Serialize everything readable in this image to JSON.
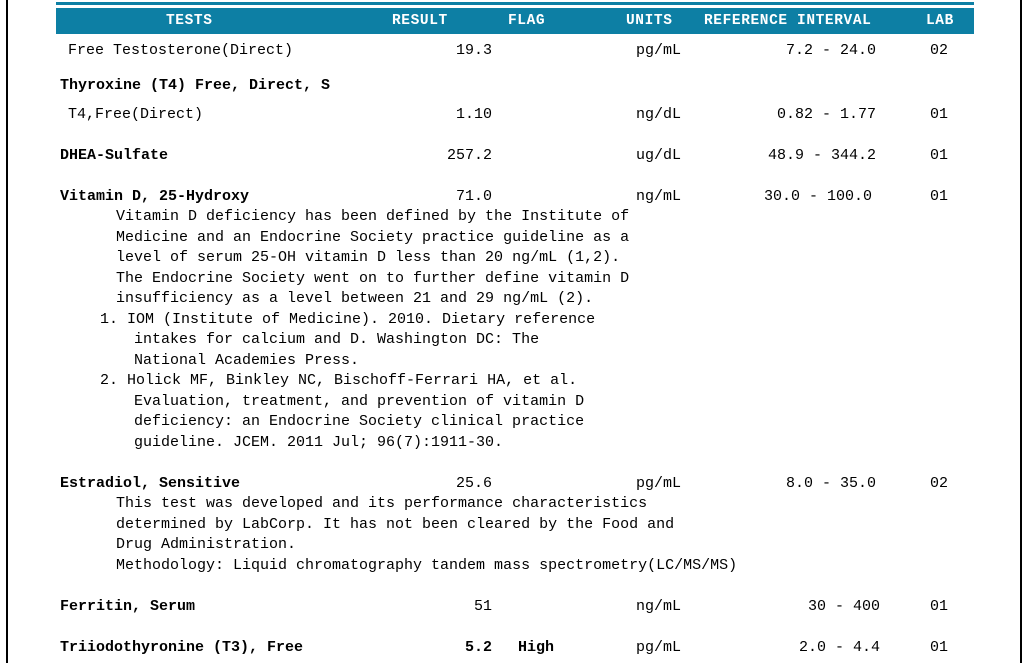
{
  "theme": {
    "header_bg": "#0d7fa4",
    "header_text": "#ffffff",
    "body_text": "#000000",
    "page_bg": "#ffffff",
    "border": "#000000"
  },
  "table": {
    "columns": {
      "tests": "TESTS",
      "result": "RESULT",
      "flag": "FLAG",
      "units": "UNITS",
      "reference_interval": "REFERENCE INTERVAL",
      "lab": "LAB"
    },
    "rows": [
      {
        "test": "Free Testosterone(Direct)",
        "bold": false,
        "result": "19.3",
        "flag": "",
        "units": "pg/mL",
        "reference": "7.2 - 24.0",
        "lab": "02"
      },
      {
        "test": "T4,Free(Direct)",
        "bold": false,
        "result": "1.10",
        "flag": "",
        "units": "ng/dL",
        "reference": "0.82 - 1.77",
        "lab": "01"
      },
      {
        "test": "DHEA-Sulfate",
        "bold": true,
        "result": "257.2",
        "flag": "",
        "units": "ug/dL",
        "reference": "48.9 - 344.2",
        "lab": "01"
      },
      {
        "test": "Vitamin D, 25-Hydroxy",
        "bold": true,
        "result": "71.0",
        "flag": "",
        "units": "ng/mL",
        "reference": "30.0 - 100.0",
        "lab": "01"
      },
      {
        "test": "Estradiol, Sensitive",
        "bold": true,
        "result": "25.6",
        "flag": "",
        "units": "pg/mL",
        "reference": "8.0 - 35.0",
        "lab": "02"
      },
      {
        "test": "Ferritin, Serum",
        "bold": true,
        "result": "51",
        "flag": "",
        "units": "ng/mL",
        "reference": "30 - 400",
        "lab": "01"
      },
      {
        "test": "Triiodothyronine (T3), Free",
        "bold": true,
        "result": "5.2",
        "flag": "High",
        "units": "pg/mL",
        "reference": "2.0 - 4.4",
        "lab": "01"
      }
    ],
    "group_headings": {
      "thyroxine": "Thyroxine (T4) Free, Direct, S"
    },
    "notes": {
      "vitamin_d": {
        "body": [
          "Vitamin D deficiency has been defined by the Institute of",
          "Medicine and an Endocrine Society practice guideline as a",
          "level of serum 25-OH vitamin D less than 20 ng/mL (1,2).",
          "The Endocrine Society went on to further define vitamin D",
          "insufficiency as a level between 21 and 29 ng/mL (2)."
        ],
        "references": [
          [
            "1. IOM (Institute of Medicine). 2010. Dietary reference",
            "intakes for calcium and D. Washington DC: The",
            "National Academies Press."
          ],
          [
            "2. Holick MF, Binkley NC, Bischoff-Ferrari HA, et al.",
            "Evaluation, treatment, and prevention of vitamin D",
            "deficiency: an Endocrine Society clinical practice",
            "guideline. JCEM. 2011 Jul; 96(7):1911-30."
          ]
        ]
      },
      "estradiol": {
        "body": [
          "This test was developed and its performance characteristics",
          "determined by LabCorp. It has not been cleared by the Food and",
          "Drug Administration.",
          "Methodology: Liquid chromatography tandem mass spectrometry(LC/MS/MS)"
        ]
      }
    }
  }
}
